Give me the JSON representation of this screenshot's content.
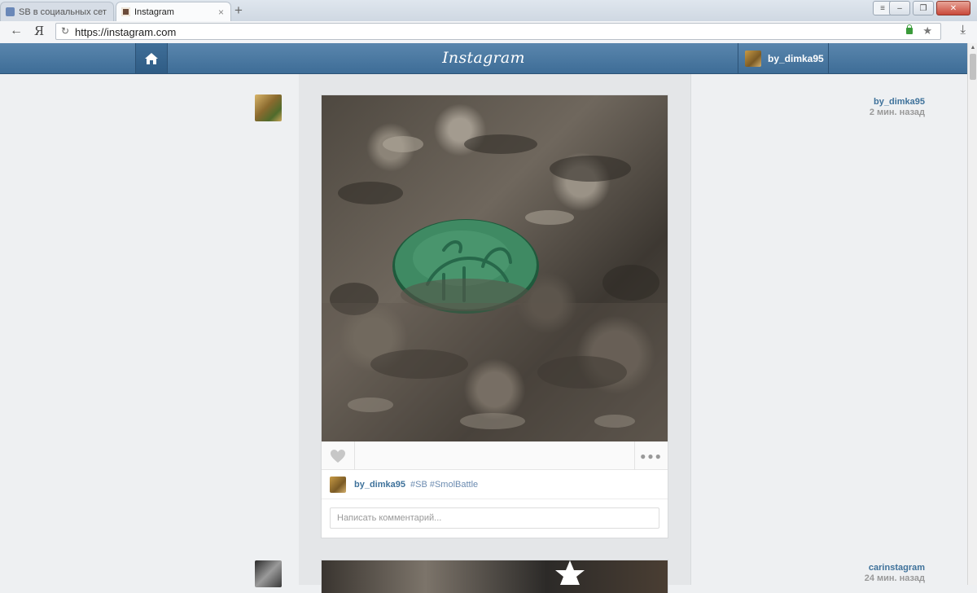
{
  "browser": {
    "tabs": [
      {
        "title": "SB в социальных сетя",
        "active": false
      },
      {
        "title": "Instagram",
        "active": true
      }
    ],
    "new_tab": "+",
    "back": "←",
    "logo": "Я",
    "reload": "↻",
    "url": "https://instagram.com",
    "bookmark": "★",
    "download": "⤓",
    "close_tab": "×"
  },
  "header": {
    "logo": "Instagram",
    "profile_name": "by_dimka95"
  },
  "posts": [
    {
      "user": "by_dimka95",
      "time": "2 мин. назад",
      "caption_user": "by_dimka95",
      "caption_tags": "#SB #SmolBattle",
      "comment_placeholder": "Написать комментарий..."
    },
    {
      "user": "carinstagram",
      "time": "24 мин. назад"
    }
  ],
  "icons": [
    "home-icon",
    "heart-icon",
    "more-icon",
    "lock-icon",
    "star-icon",
    "download-icon"
  ],
  "colors": {
    "header": "#4a7aa5",
    "username": "#3f729b",
    "hashtag": "#6b8bb0"
  }
}
